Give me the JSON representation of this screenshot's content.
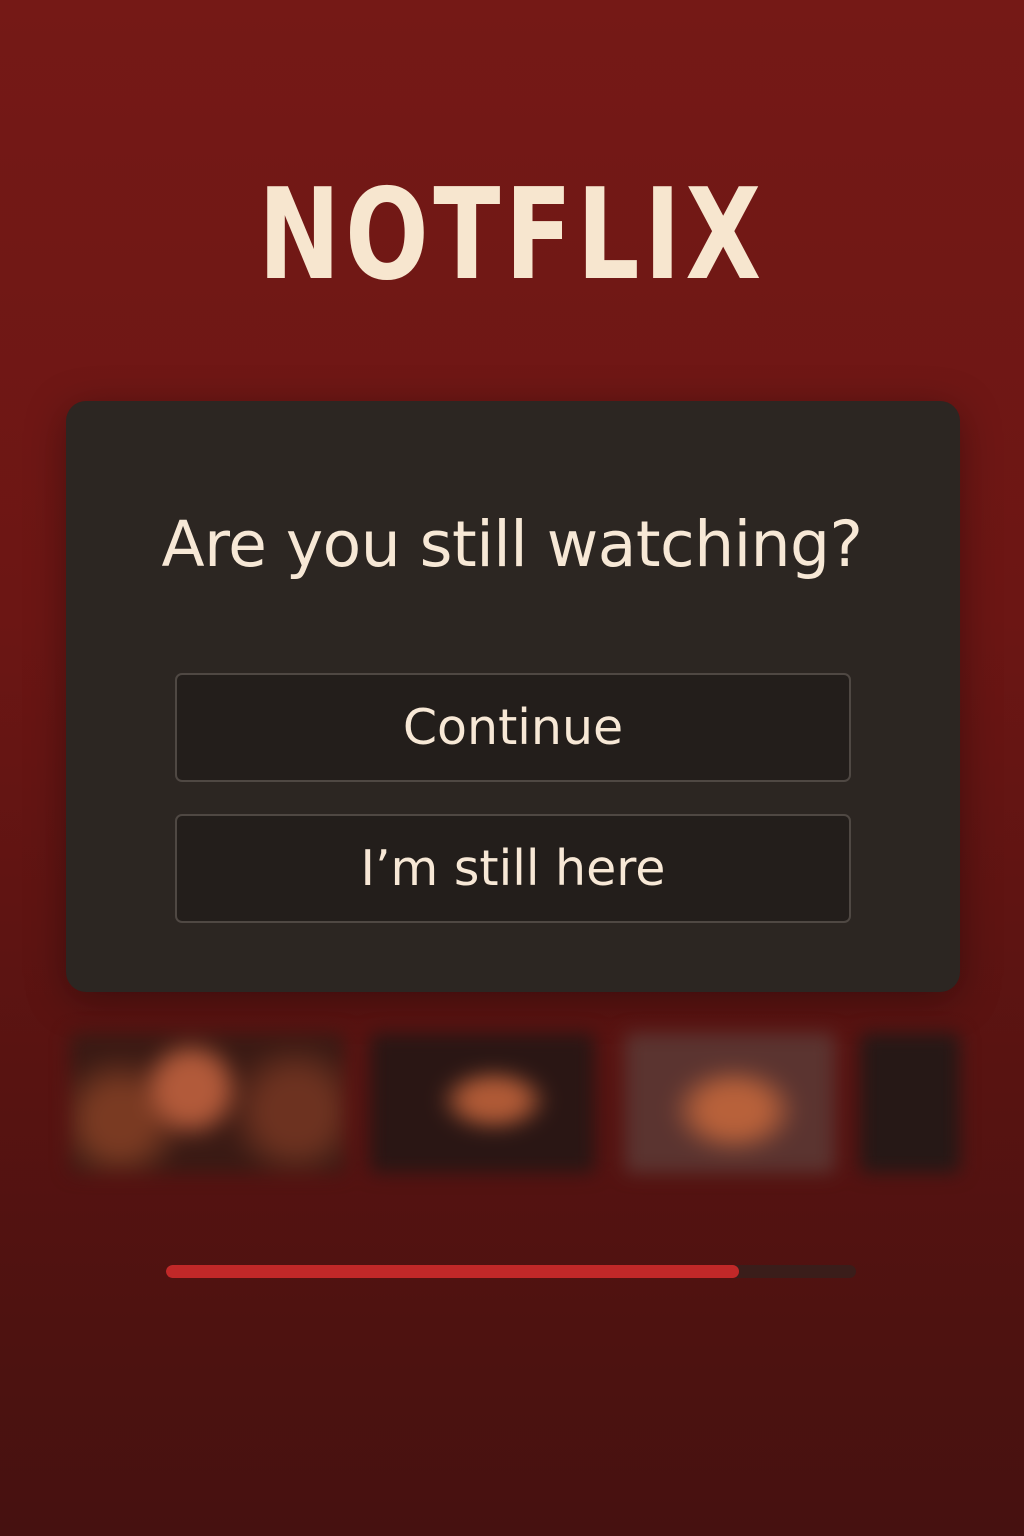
{
  "brand": {
    "logo_text": "NOTFLIX",
    "logo_color": "#f7e6cf"
  },
  "dialog": {
    "title": "Are you still watching?",
    "continue_label": "Continue",
    "still_here_label": "I’m still here"
  },
  "thumbnails": [
    {
      "name": "thumbnail-1"
    },
    {
      "name": "thumbnail-2"
    },
    {
      "name": "thumbnail-3"
    },
    {
      "name": "thumbnail-4"
    }
  ],
  "playback": {
    "progress": 0.83
  },
  "colors": {
    "background": "#6c1614",
    "dialog_background": "#2c2622",
    "text": "#f7e8d6",
    "accent_progress": "#c12828"
  }
}
